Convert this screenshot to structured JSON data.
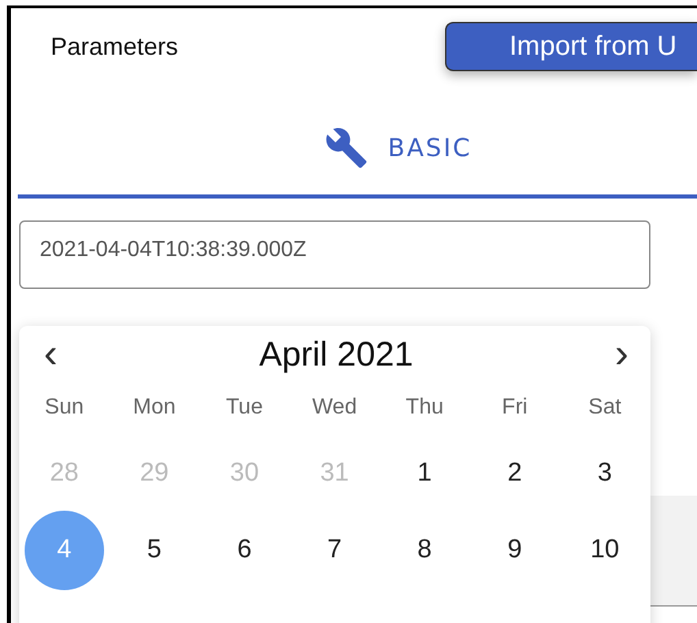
{
  "header": {
    "title": "Parameters",
    "import_button": "Import from U"
  },
  "tabs": [
    {
      "label": "BASIC",
      "selected": true
    }
  ],
  "date_field": {
    "value": "2021-04-04T10:38:39.000Z"
  },
  "calendar": {
    "month": "April 2021",
    "prev": "‹",
    "next": "›",
    "weekdays": [
      "Sun",
      "Mon",
      "Tue",
      "Wed",
      "Thu",
      "Fri",
      "Sat"
    ],
    "weeks": [
      [
        {
          "day": "28",
          "outside": true,
          "selected": false
        },
        {
          "day": "29",
          "outside": true,
          "selected": false
        },
        {
          "day": "30",
          "outside": true,
          "selected": false
        },
        {
          "day": "31",
          "outside": true,
          "selected": false
        },
        {
          "day": "1",
          "outside": false,
          "selected": false
        },
        {
          "day": "2",
          "outside": false,
          "selected": false
        },
        {
          "day": "3",
          "outside": false,
          "selected": false
        }
      ],
      [
        {
          "day": "4",
          "outside": false,
          "selected": true
        },
        {
          "day": "5",
          "outside": false,
          "selected": false
        },
        {
          "day": "6",
          "outside": false,
          "selected": false
        },
        {
          "day": "7",
          "outside": false,
          "selected": false
        },
        {
          "day": "8",
          "outside": false,
          "selected": false
        },
        {
          "day": "9",
          "outside": false,
          "selected": false
        },
        {
          "day": "10",
          "outside": false,
          "selected": false
        }
      ]
    ]
  }
}
